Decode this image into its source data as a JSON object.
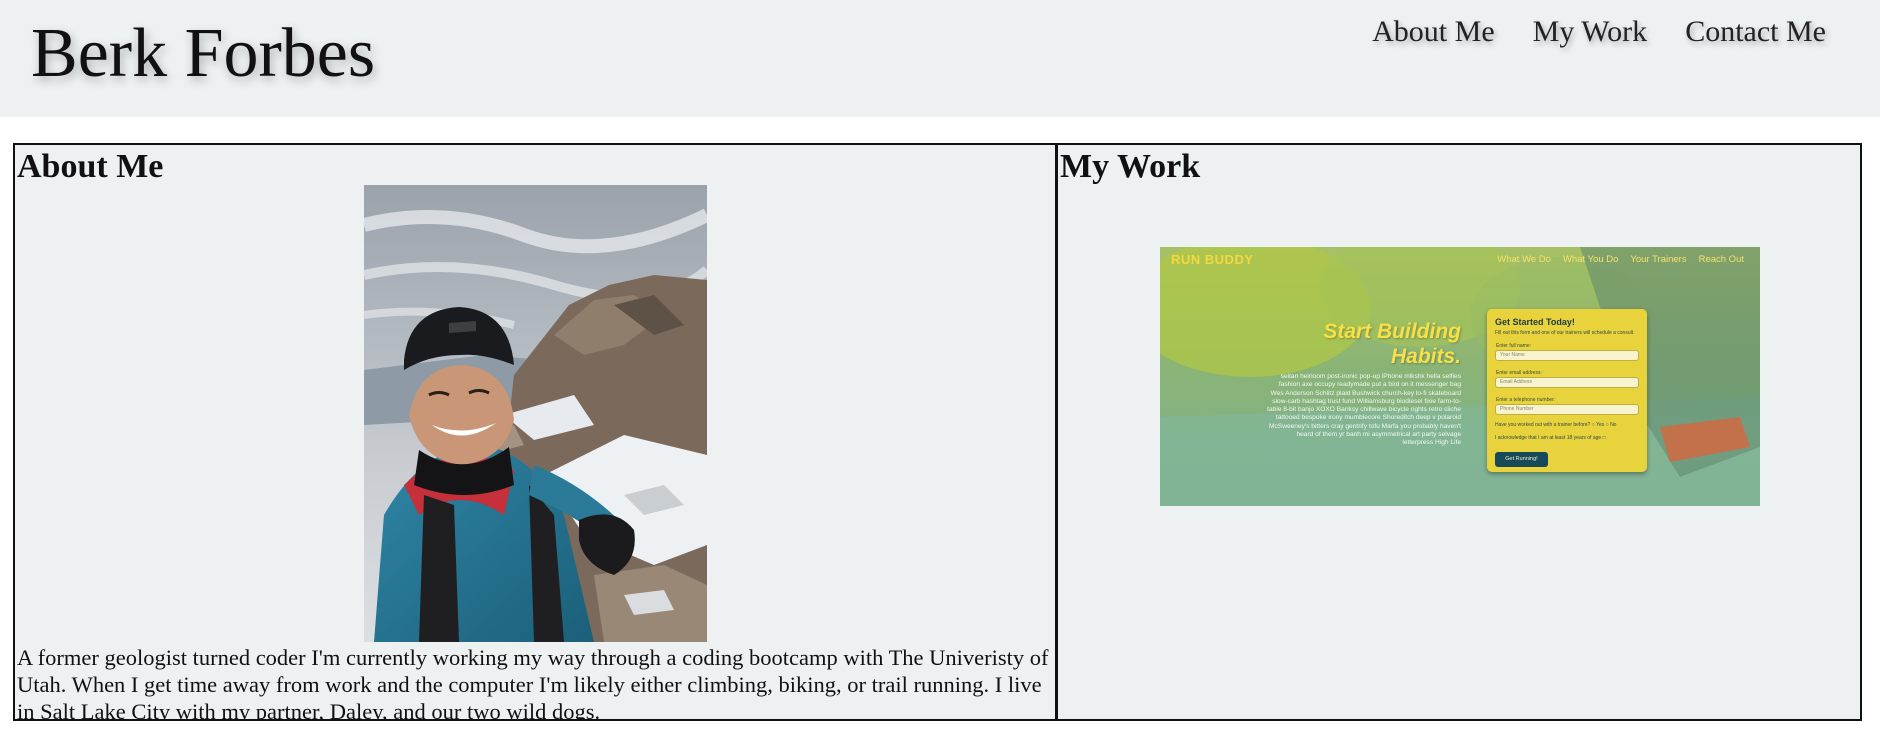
{
  "header": {
    "site_title": "Berk Forbes",
    "nav": [
      "About Me",
      "My Work",
      "Contact Me"
    ]
  },
  "about": {
    "heading": "About Me",
    "bio": "A former geologist turned coder I'm currently working my way through a coding bootcamp with The Univeristy of Utah. When I get time away from work and the computer I'm likely either climbing, biking, or trail running. I live in Salt Lake City with my partner, Daley, and our two wild dogs."
  },
  "work": {
    "heading": "My Work",
    "project": {
      "brand": "RUN BUDDY",
      "nav": [
        "What We Do",
        "What You Do",
        "Your Trainers",
        "Reach Out"
      ],
      "hero_line1": "Start Building",
      "hero_line2": "Habits.",
      "body_text": "seitan heirloom post-ironic pop-up iPhone mlkshk hella selfies fashion axe occupy readymade put a bird on it messenger bag Wes Anderson Schlitz plaid Bushwick church-key lo-fi skateboard slow-carb hashtag trust fund Williamsburg biodiesel fixie farm-to-table 8-bit banjo XOXO Banksy chillwave bicycle rights retro cliche tattooed bespoke irony mumblecore Shoreditch deep v polaroid McSweeney's bitters cray gentrify tofu Marfa you probably haven't heard of them yr banh mi asymmetrical art party selvage letterpress High Life",
      "form_title": "Get Started Today!",
      "form_subtitle": "Fill out this form and one of our trainers will schedule a consult.",
      "name_label": "Enter full name:",
      "name_placeholder": "Your Name",
      "email_label": "Enter email address:",
      "email_placeholder": "Email Address",
      "phone_label": "Enter a telephone number:",
      "phone_placeholder": "Phone Number",
      "trainer_question": "Have you worked out with a trainer before?",
      "yes_label": "Yes",
      "no_label": "No",
      "age_ack": "I acknowledge that I am at least 18 years of age",
      "button_label": "Get Running!"
    }
  },
  "colors": {
    "panel_bg": "#eef1f2",
    "project_yellow": "#f3d840",
    "project_teal": "#174a59"
  }
}
